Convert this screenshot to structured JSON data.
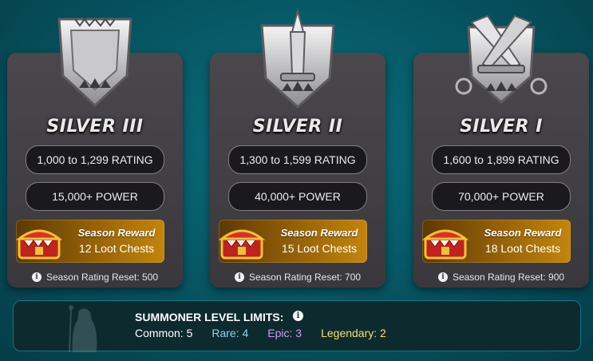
{
  "colors": {
    "background": "#075866",
    "card": "#423f45",
    "pill": "#1a1a1c",
    "reward_gold": "#c2850c",
    "rare": "#8fd3f0",
    "epic": "#d29af0",
    "legendary": "#f2e070"
  },
  "tiers": [
    {
      "name": "SILVER III",
      "icon": "silver-shield-icon",
      "rating": "1,000 to 1,299 RATING",
      "power": "15,000+ POWER",
      "reward_title": "Season Reward",
      "reward_chests": "12 Loot Chests",
      "reset": "Season Rating Reset: 500"
    },
    {
      "name": "SILVER II",
      "icon": "silver-shield-sword-icon",
      "rating": "1,300 to 1,599 RATING",
      "power": "40,000+ POWER",
      "reward_title": "Season Reward",
      "reward_chests": "15 Loot Chests",
      "reset": "Season Rating Reset: 700"
    },
    {
      "name": "SILVER I",
      "icon": "silver-shield-crossed-swords-icon",
      "rating": "1,600 to 1,899 RATING",
      "power": "70,000+ POWER",
      "reward_title": "Season Reward",
      "reward_chests": "18 Loot Chests",
      "reset": "Season Rating Reset: 900"
    }
  ],
  "limits": {
    "title": "SUMMONER LEVEL LIMITS:",
    "common": "Common: 5",
    "rare": "Rare: 4",
    "epic": "Epic: 3",
    "legendary": "Legendary: 2"
  }
}
